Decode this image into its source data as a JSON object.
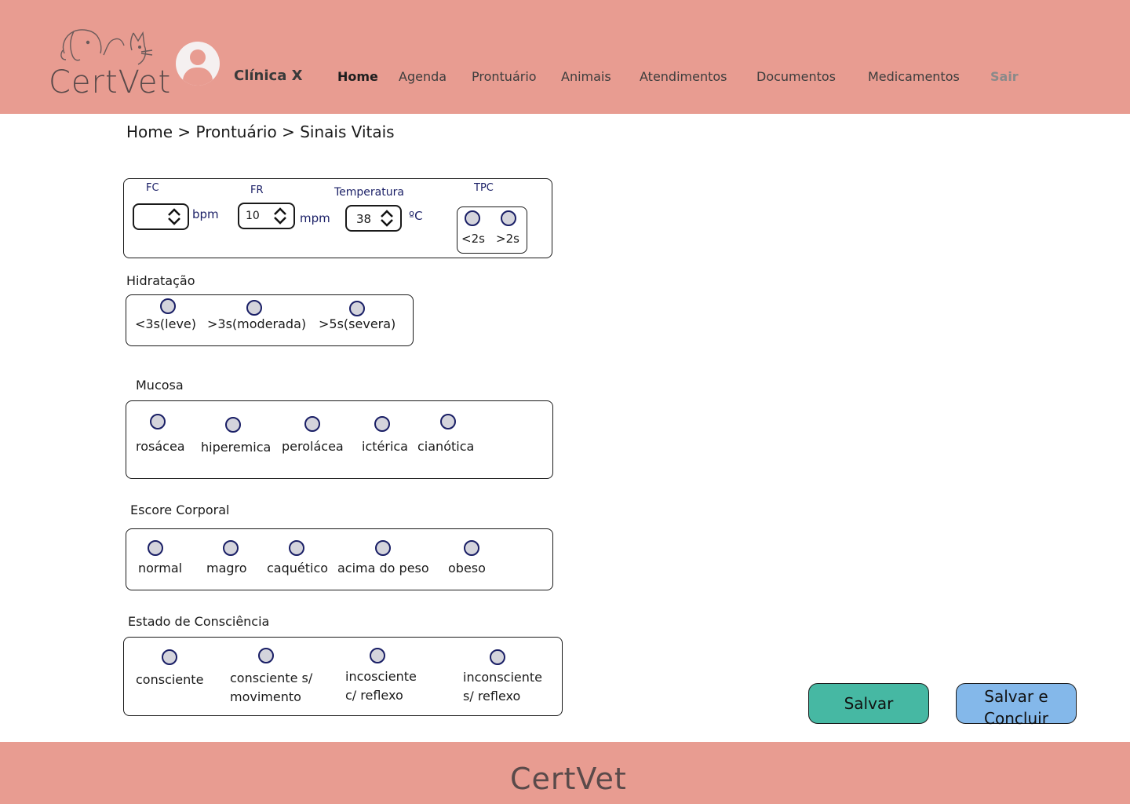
{
  "header": {
    "logo": "CertVet",
    "clinic_name": "Clínica X",
    "nav": [
      {
        "label": "Home"
      },
      {
        "label": "Agenda"
      },
      {
        "label": "Prontuário"
      },
      {
        "label": "Animais"
      },
      {
        "label": "Atendimentos"
      },
      {
        "label": "Documentos"
      },
      {
        "label": "Medicamentos"
      },
      {
        "label": "Sair"
      }
    ]
  },
  "breadcrumb": "Home > Prontuário > Sinais Vitais",
  "vitals": {
    "fc": {
      "label": "FC",
      "value": "",
      "unit": "bpm"
    },
    "fr": {
      "label": "FR",
      "value": "10",
      "unit": "mpm"
    },
    "temp": {
      "label": "Temperatura",
      "value": "38",
      "unit": "ºC"
    },
    "tpc": {
      "label": "TPC",
      "options": [
        "<2s",
        ">2s"
      ]
    }
  },
  "hidratacao": {
    "title": "Hidratação",
    "options": [
      "<3s(leve)",
      ">3s(moderada)",
      ">5s(severa)"
    ]
  },
  "mucosa": {
    "title": "Mucosa",
    "options": [
      "rosácea",
      "hiperemica",
      "perolácea",
      "ictérica",
      "cianótica"
    ]
  },
  "escore": {
    "title": "Escore Corporal",
    "options": [
      "normal",
      "magro",
      "caquético",
      "acima do peso",
      "obeso"
    ]
  },
  "consciencia": {
    "title": "Estado de Consciência",
    "options": [
      [
        "consciente"
      ],
      [
        "consciente s/",
        "movimento"
      ],
      [
        "incosciente",
        "c/ reflexo"
      ],
      [
        "inconsciente",
        "s/ reflexo"
      ]
    ]
  },
  "actions": {
    "save": "Salvar",
    "save_conclude_line1": "Salvar e",
    "save_conclude_line2": "Concluir"
  },
  "footer": {
    "logo": "CertVet"
  },
  "colors": {
    "header_bg": "#e89c91",
    "save_btn": "#46b8a3",
    "conclude_btn": "#84b8ea",
    "radio_border": "#1a1f66"
  }
}
